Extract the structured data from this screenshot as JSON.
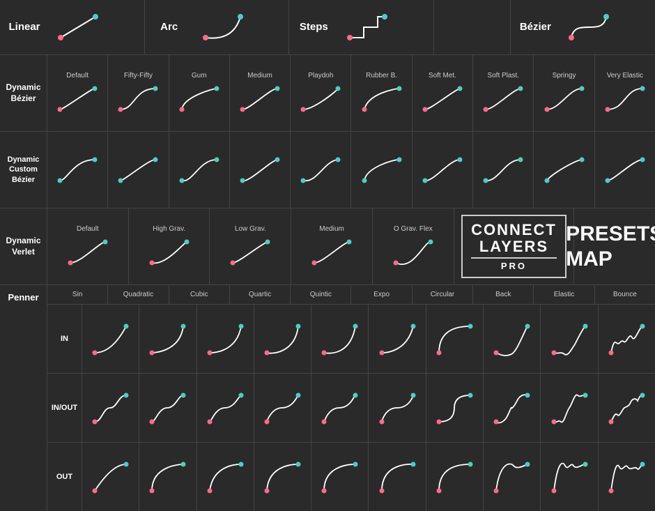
{
  "rows": {
    "row1": {
      "cells": [
        {
          "label": "Linear",
          "curveType": "linear"
        },
        {
          "label": "Arc",
          "curveType": "arc"
        },
        {
          "label": "Steps",
          "curveType": "steps"
        },
        {
          "label": "",
          "curveType": "none"
        },
        {
          "label": "Bézier",
          "curveType": "bezier"
        }
      ]
    },
    "row2": {
      "rowLabel": "Dynamic\nBézier",
      "cells": [
        {
          "label": "Default",
          "curveType": "ease"
        },
        {
          "label": "Fifty-Fifty",
          "curveType": "ease"
        },
        {
          "label": "Gum",
          "curveType": "ease-in"
        },
        {
          "label": "Medium",
          "curveType": "ease"
        },
        {
          "label": "Playdoh",
          "curveType": "ease-out"
        },
        {
          "label": "Rubber B.",
          "curveType": "ease"
        },
        {
          "label": "Soft Met.",
          "curveType": "ease"
        },
        {
          "label": "Soft Plast.",
          "curveType": "ease"
        },
        {
          "label": "Springy",
          "curveType": "ease"
        },
        {
          "label": "Very Elastic",
          "curveType": "ease"
        }
      ]
    },
    "row3": {
      "rowLabel": "Dynamic\nCustom\nBézier",
      "cells": [
        {
          "label": "",
          "curveType": "ease-custom"
        },
        {
          "label": "",
          "curveType": "ease-custom"
        },
        {
          "label": "",
          "curveType": "ease-custom"
        },
        {
          "label": "",
          "curveType": "ease-custom"
        },
        {
          "label": "",
          "curveType": "ease-custom"
        },
        {
          "label": "",
          "curveType": "ease-custom"
        },
        {
          "label": "",
          "curveType": "ease-custom"
        },
        {
          "label": "",
          "curveType": "ease-custom"
        },
        {
          "label": "",
          "curveType": "ease-custom"
        },
        {
          "label": "",
          "curveType": "ease-custom"
        }
      ]
    },
    "row4": {
      "rowLabel": "Dynamic\nVerlet",
      "cells": [
        {
          "label": "Default",
          "curveType": "verlet"
        },
        {
          "label": "High Grav.",
          "curveType": "verlet2"
        },
        {
          "label": "Low Grav.",
          "curveType": "verlet"
        },
        {
          "label": "Medium",
          "curveType": "verlet"
        },
        {
          "label": "O Grav. Flex",
          "curveType": "verlet3"
        },
        {
          "label": "LOGO",
          "curveType": "logo"
        },
        {
          "label": "PRESETS",
          "curveType": "presets"
        }
      ]
    },
    "penner": {
      "rowLabel": "Penner",
      "subRowLabels": [
        "IN",
        "IN/OUT",
        "OUT"
      ],
      "colLabels": [
        "Sin",
        "Quadratic",
        "Cubic",
        "Quartic",
        "Quintic",
        "Expo",
        "Circular",
        "Back",
        "Elastic",
        "Bounce"
      ],
      "types": {
        "in": [
          "sin-in",
          "quad-in",
          "cubic-in",
          "quart-in",
          "quint-in",
          "expo-in",
          "circ-in",
          "back-in",
          "elastic-in",
          "bounce-in"
        ],
        "inout": [
          "sin-inout",
          "quad-inout",
          "cubic-inout",
          "quart-inout",
          "quint-inout",
          "expo-inout",
          "circ-inout",
          "back-inout",
          "elastic-inout",
          "bounce-inout"
        ],
        "out": [
          "sin-out",
          "quad-out",
          "cubic-out",
          "quart-out",
          "quint-out",
          "expo-out",
          "circ-out",
          "back-out",
          "elastic-out",
          "bounce-out"
        ]
      }
    }
  },
  "logo": {
    "connect": "CONNECT",
    "layers": "LAYERS",
    "pro": "PRO",
    "presetsMap": "PRESETS\nMAP"
  },
  "colors": {
    "pink": "#ff6b8a",
    "teal": "#4ecdc4",
    "white": "#ffffff",
    "bg": "#2a2a2a",
    "border": "#444444"
  }
}
